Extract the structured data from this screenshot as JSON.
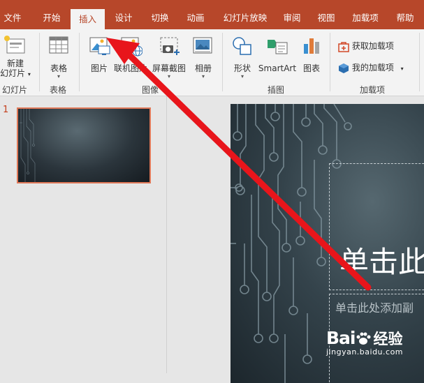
{
  "tabs": [
    "文件",
    "开始",
    "插入",
    "设计",
    "切换",
    "动画",
    "幻灯片放映",
    "审阅",
    "视图",
    "加载项",
    "帮助"
  ],
  "ribbon": {
    "new_slide": "新建",
    "new_slide2": "幻灯片",
    "table": "表格",
    "picture": "图片",
    "online_picture": "联机图片",
    "screenshot": "屏幕截图",
    "album": "相册",
    "shapes": "形状",
    "smartart": "SmartArt",
    "chart": "图表",
    "get_addins": "获取加载项",
    "my_addins": "我的加载项",
    "groups": {
      "slides": "幻灯片",
      "tables": "表格",
      "images": "图像",
      "illustrations": "插图",
      "addins": "加载项"
    }
  },
  "thumbnails": {
    "slide_number": "1"
  },
  "slide": {
    "title_placeholder": "单击此",
    "subtitle_placeholder": "单击此处添加副"
  },
  "watermark": {
    "brand": "Bai",
    "brand2": "经验",
    "url": "jingyan.baidu.com"
  },
  "colors": {
    "accent": "#b7472a",
    "arrow": "#e8151b",
    "slide_bg": "#2f3c43"
  }
}
